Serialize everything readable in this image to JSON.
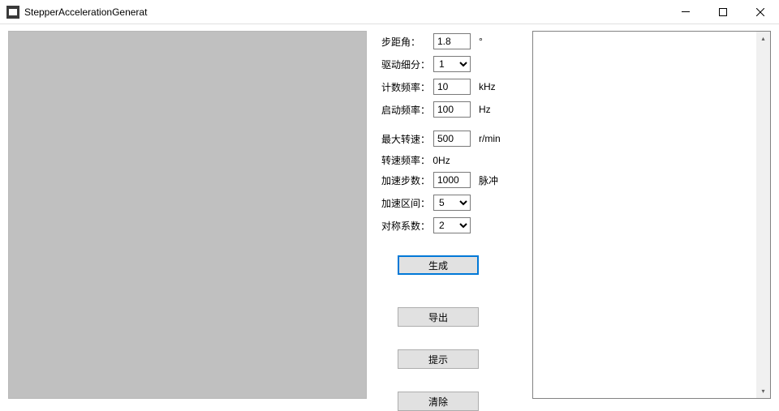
{
  "window": {
    "title": "StepperAccelerationGenerat"
  },
  "form": {
    "step_angle": {
      "label": "步距角：",
      "value": "1.8",
      "unit": "°"
    },
    "subdivision": {
      "label": "驱动细分：",
      "value": "1"
    },
    "count_freq": {
      "label": "计数频率：",
      "value": "10",
      "unit": "kHz"
    },
    "start_freq": {
      "label": "启动频率：",
      "value": "100",
      "unit": "Hz"
    },
    "max_speed": {
      "label": "最大转速：",
      "value": "500",
      "unit": "r/min"
    },
    "speed_freq": {
      "label": "转速频率：",
      "value_text": "0Hz"
    },
    "accel_steps": {
      "label": "加速步数：",
      "value": "1000",
      "unit": "脉冲"
    },
    "accel_range": {
      "label": "加速区间：",
      "value": "5"
    },
    "sym_coeff": {
      "label": "对称系数：",
      "value": "2"
    }
  },
  "buttons": {
    "generate": "生成",
    "export": "导出",
    "hint": "提示",
    "clear": "清除"
  }
}
